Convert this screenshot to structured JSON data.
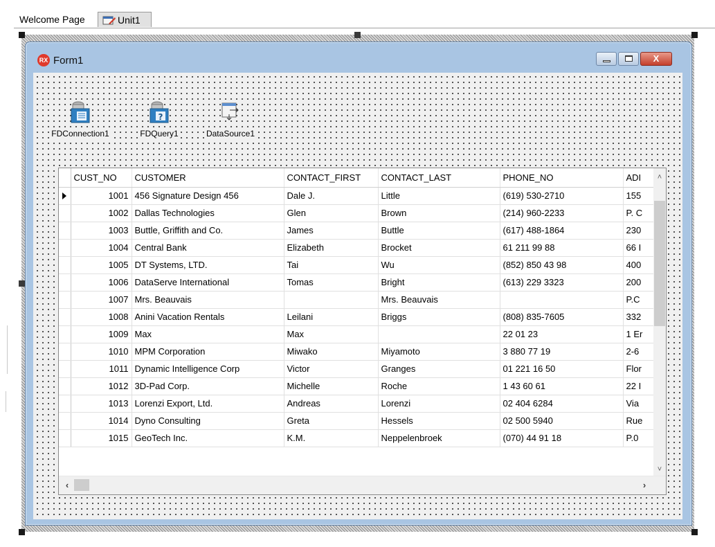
{
  "editor_tabs": {
    "welcome_label": "Welcome Page",
    "unit_label": "Unit1"
  },
  "form": {
    "title": "Form1",
    "badge": "RX",
    "controls": {
      "minimize": "–",
      "maximize": "□",
      "close": "X"
    }
  },
  "components": [
    {
      "label": "FDConnection1",
      "icon": "database-connection-icon"
    },
    {
      "label": "FDQuery1",
      "icon": "database-query-icon"
    },
    {
      "label": "DataSource1",
      "icon": "datasource-icon"
    }
  ],
  "grid": {
    "columns": [
      "CUST_NO",
      "CUSTOMER",
      "CONTACT_FIRST",
      "CONTACT_LAST",
      "PHONE_NO",
      "ADI"
    ],
    "rows": [
      [
        "1001",
        "456 Signature Design 456",
        "Dale J.",
        "Little",
        "(619) 530-2710",
        "155"
      ],
      [
        "1002",
        "Dallas Technologies",
        "Glen",
        "Brown",
        "(214) 960-2233",
        "P. C"
      ],
      [
        "1003",
        "Buttle, Griffith and Co.",
        "James",
        "Buttle",
        "(617) 488-1864",
        "230"
      ],
      [
        "1004",
        "Central Bank",
        "Elizabeth",
        "Brocket",
        "61 211 99 88",
        "66 I"
      ],
      [
        "1005",
        "DT Systems, LTD.",
        "Tai",
        "Wu",
        "(852) 850 43 98",
        "400"
      ],
      [
        "1006",
        "DataServe International",
        "Tomas",
        "Bright",
        "(613) 229 3323",
        "200"
      ],
      [
        "1007",
        "Mrs. Beauvais",
        "",
        "Mrs. Beauvais",
        "",
        "P.C"
      ],
      [
        "1008",
        "Anini Vacation Rentals",
        "Leilani",
        "Briggs",
        "(808) 835-7605",
        "332"
      ],
      [
        "1009",
        "Max",
        "Max",
        "",
        "22 01 23",
        "1 Er"
      ],
      [
        "1010",
        "MPM Corporation",
        "Miwako",
        "Miyamoto",
        "3 880 77 19",
        "2-6"
      ],
      [
        "1011",
        "Dynamic Intelligence Corp",
        "Victor",
        "Granges",
        "01 221 16 50",
        "Flor"
      ],
      [
        "1012",
        "3D-Pad Corp.",
        "Michelle",
        "Roche",
        "1 43 60 61",
        "22 I"
      ],
      [
        "1013",
        "Lorenzi Export, Ltd.",
        "Andreas",
        "Lorenzi",
        "02 404 6284",
        "Via"
      ],
      [
        "1014",
        "Dyno Consulting",
        "Greta",
        "Hessels",
        "02 500 5940",
        "Rue"
      ],
      [
        "1015",
        "GeoTech Inc.",
        "K.M.",
        "Neppelenbroek",
        "(070) 44 91 18",
        "P.0"
      ]
    ],
    "current_row_index": 0
  },
  "colors": {
    "form_frame": "#a9c5e3",
    "close_button": "#c4402c",
    "rx_badge": "#e0392b"
  }
}
